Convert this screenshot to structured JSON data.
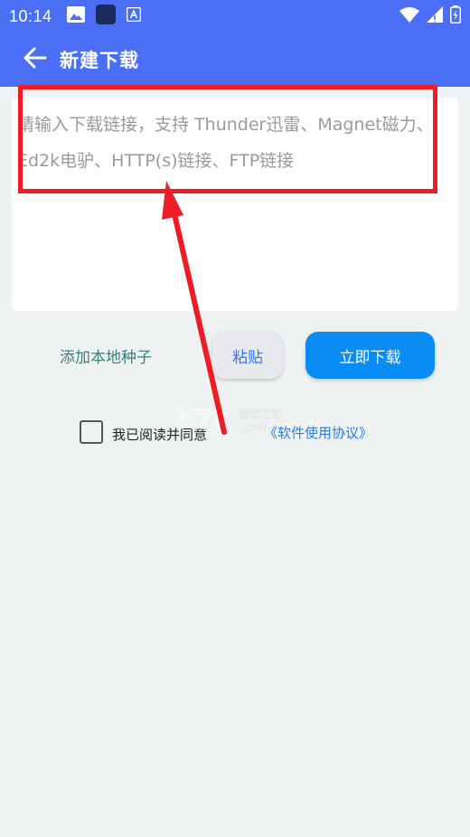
{
  "status_bar": {
    "time": "10:14",
    "left_icons": [
      "image-icon",
      "app-square-icon",
      "a-badge-icon"
    ],
    "right_icons": [
      "wifi-icon",
      "signal-icon",
      "battery-icon"
    ]
  },
  "app_bar": {
    "back_icon": "arrow-left-icon",
    "title": "新建下载"
  },
  "input": {
    "value": "",
    "placeholder": "请输入下载链接，支持 Thunder迅雷、Magnet磁力、Ed2k电驴、HTTP(s)链接、FTP链接"
  },
  "actions": {
    "add_local_seed": "添加本地种子",
    "paste": "粘贴",
    "download_now": "立即下载"
  },
  "agreement": {
    "checked": false,
    "prefix": "我已阅读并同意",
    "link": "《软件使用协议》"
  },
  "watermark": {
    "logo": "K73",
    "cn": "游戏之家",
    "domain": ".com"
  },
  "colors": {
    "primary": "#4a6ff5",
    "download_button": "#0a8cf5",
    "link": "#2a7de1",
    "seed_text": "#3c7f7b",
    "annotation": "#ee1c24",
    "background": "#eef2f3"
  }
}
